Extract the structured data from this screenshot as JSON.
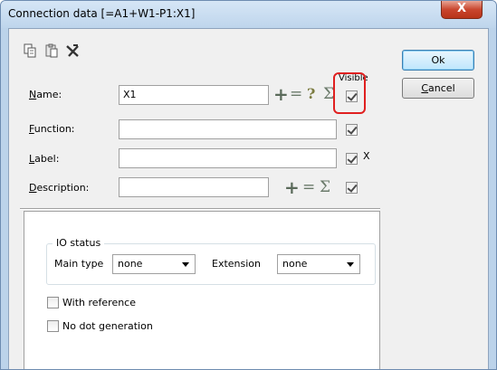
{
  "window": {
    "title": "Connection data [=A1+W1-P1:X1]",
    "close_glyph": "X"
  },
  "toolbar": {
    "icons": [
      "copy-icon",
      "paste-icon",
      "delete-icon"
    ]
  },
  "fields": {
    "visible_header": "Visible",
    "name": {
      "label_key": "N",
      "label_rest": "ame:",
      "value": "X1",
      "visible": true
    },
    "function": {
      "label_key": "F",
      "label_rest": "unction:",
      "value": "",
      "visible": true
    },
    "label": {
      "label_key": "L",
      "label_rest": "abel:",
      "value": "",
      "visible": true,
      "suffix": "X"
    },
    "description": {
      "label_key": "D",
      "label_rest": "escription:",
      "value": "",
      "visible": true
    }
  },
  "symbols": {
    "plus": "+",
    "equals": "=",
    "question": "?",
    "sum": "Σ"
  },
  "buttons": {
    "ok": "Ok",
    "cancel_key": "C",
    "cancel_rest": "ancel"
  },
  "io_status": {
    "title": "IO status",
    "main_type_label": "Main type",
    "main_type_value": "none",
    "extension_label": "Extension",
    "extension_value": "none"
  },
  "options": {
    "with_reference": {
      "label": "With reference",
      "checked": false
    },
    "no_dot_generation": {
      "label": "No dot generation",
      "checked": false
    }
  },
  "colors": {
    "highlight": "#e02020",
    "title_bar": "#bcd3ea",
    "close_button": "#c9462e"
  }
}
